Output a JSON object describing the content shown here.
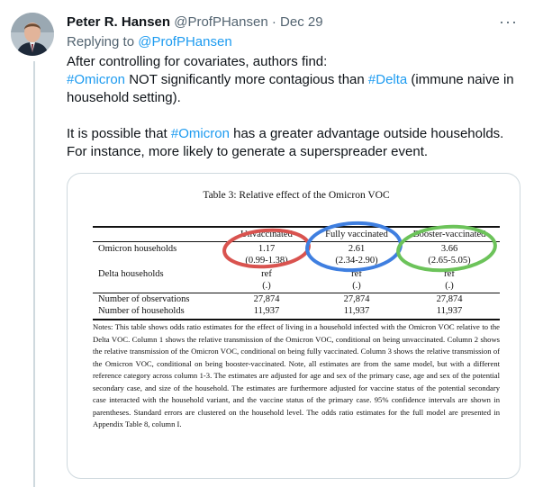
{
  "tweet": {
    "author_name": "Peter R. Hansen",
    "author_handle": "@ProfPHansen",
    "separator": "·",
    "date": "Dec 29",
    "more_label": "···",
    "replying_prefix": "Replying to",
    "replying_handle": "@ProfPHansen",
    "p1_line1": "After controlling for covariates, authors find:",
    "p1_tag1": "#Omicron",
    "p1_mid": " NOT significantly more contagious than ",
    "p1_tag2": "#Delta",
    "p1_end": " (immune naive in household setting).",
    "p2_start": "It is possible that ",
    "p2_tag": "#Omicron",
    "p2_end": " has a greater advantage outside households. For instance, more likely to generate a superspreader event."
  },
  "table": {
    "caption": "Table 3: Relative effect of the Omicron VOC",
    "headers": [
      "Unvaccinated",
      "Fully vaccinated",
      "Booster-vaccinated"
    ],
    "rows": [
      {
        "label": "Omicron households",
        "values": [
          "1.17",
          "2.61",
          "3.66"
        ],
        "ci": [
          "(0.99-1.38)",
          "(2.34-2.90)",
          "(2.65-5.05)"
        ]
      },
      {
        "label": "Delta households",
        "values": [
          "ref",
          "ref",
          "ref"
        ],
        "ci": [
          "(.)",
          "(.)",
          "(.)"
        ]
      },
      {
        "label": "Number of observations",
        "values": [
          "27,874",
          "27,874",
          "27,874"
        ]
      },
      {
        "label": "Number of households",
        "values": [
          "11,937",
          "11,937",
          "11,937"
        ]
      }
    ],
    "notes": "Notes: This table shows odds ratio estimates for the effect of living in a household infected with the Omicron VOC relative to the Delta VOC. Column 1 shows the relative transmission of the Omicron VOC, conditional on being unvaccinated. Column 2 shows the relative transmission of the Omicron VOC, conditional on being fully vaccinated. Column 3 shows the relative transmission of the Omicron VOC, conditional on being booster-vaccinated. Note, all estimates are from the same model, but with a different reference category across column 1-3. The estimates are adjusted for age and sex of the primary case, age and sex of the potential secondary case, and size of the household. The estimates are furthermore adjusted for vaccine status of the potential secondary case interacted with the household variant, and the vaccine status of the primary case. 95% confidence intervals are shown in parentheses. Standard errors are clustered on the household level. The odds ratio estimates for the full model are presented in Appendix Table 8, column I."
  },
  "annotation_colors": {
    "red": "#d9534f",
    "blue": "#3f7fe0",
    "green": "#6cc35a"
  },
  "colors": {
    "link": "#1d9bf0",
    "muted": "#536471",
    "text": "#0f1419"
  }
}
